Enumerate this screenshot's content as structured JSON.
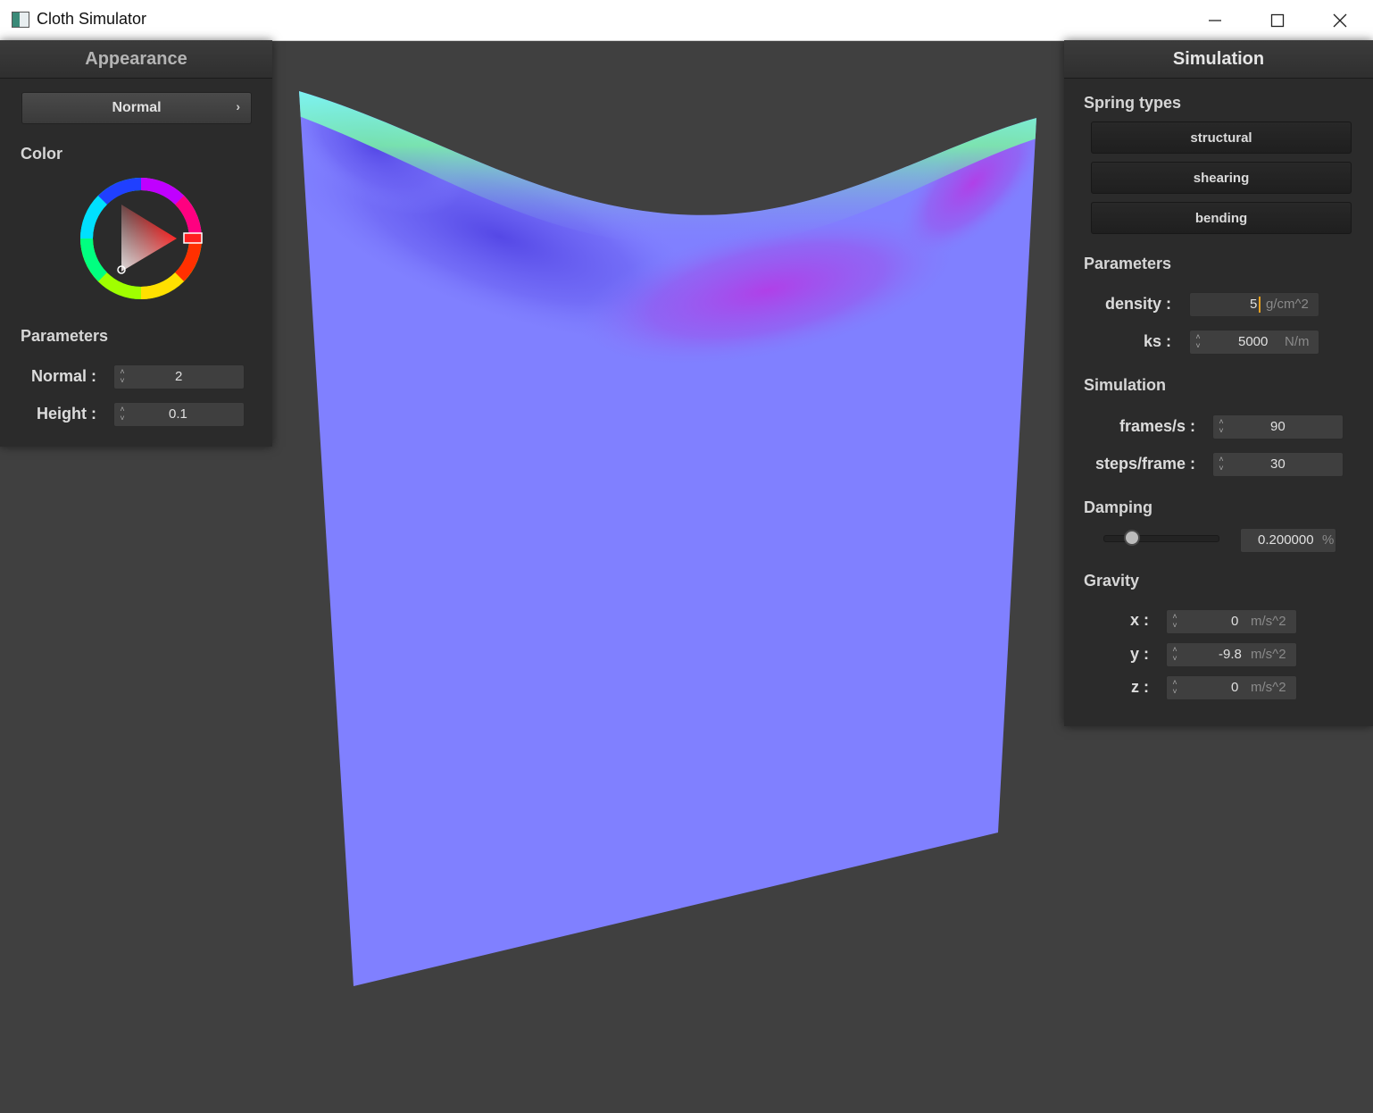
{
  "window": {
    "title": "Cloth Simulator",
    "minimize_icon": "minimize-icon",
    "maximize_icon": "maximize-icon",
    "close_icon": "close-icon"
  },
  "colors": {
    "cloth_base": "#8080ff",
    "viewport_background": "#404040",
    "panel_background": "#2b2b2b"
  },
  "appearance": {
    "header": "Appearance",
    "shader_dropdown": {
      "selected": "Normal",
      "icon": "chevron-right-icon"
    },
    "color_label": "Color",
    "color_picker": {
      "selected_hue_color": "#ff0000",
      "icon": "color-wheel-icon"
    },
    "parameters_label": "Parameters",
    "normal": {
      "label": "Normal :",
      "value": "2"
    },
    "height": {
      "label": "Height :",
      "value": "0.1"
    }
  },
  "simulation": {
    "header": "Simulation",
    "spring_types_label": "Spring types",
    "spring_buttons": [
      "structural",
      "shearing",
      "bending"
    ],
    "parameters_label": "Parameters",
    "density": {
      "label": "density :",
      "value": "5",
      "unit": "g/cm^2"
    },
    "ks": {
      "label": "ks :",
      "value": "5000",
      "unit": "N/m"
    },
    "simulation_label": "Simulation",
    "frames_per_s": {
      "label": "frames/s :",
      "value": "90"
    },
    "steps_per_frame": {
      "label": "steps/frame :",
      "value": "30"
    },
    "damping_label": "Damping",
    "damping": {
      "value": "0.200000",
      "unit": "%",
      "slider_fraction": 0.2
    },
    "gravity_label": "Gravity",
    "gravity": [
      {
        "label": "x :",
        "value": "0",
        "unit": "m/s^2"
      },
      {
        "label": "y :",
        "value": "-9.8",
        "unit": "m/s^2"
      },
      {
        "label": "z :",
        "value": "0",
        "unit": "m/s^2"
      }
    ]
  }
}
